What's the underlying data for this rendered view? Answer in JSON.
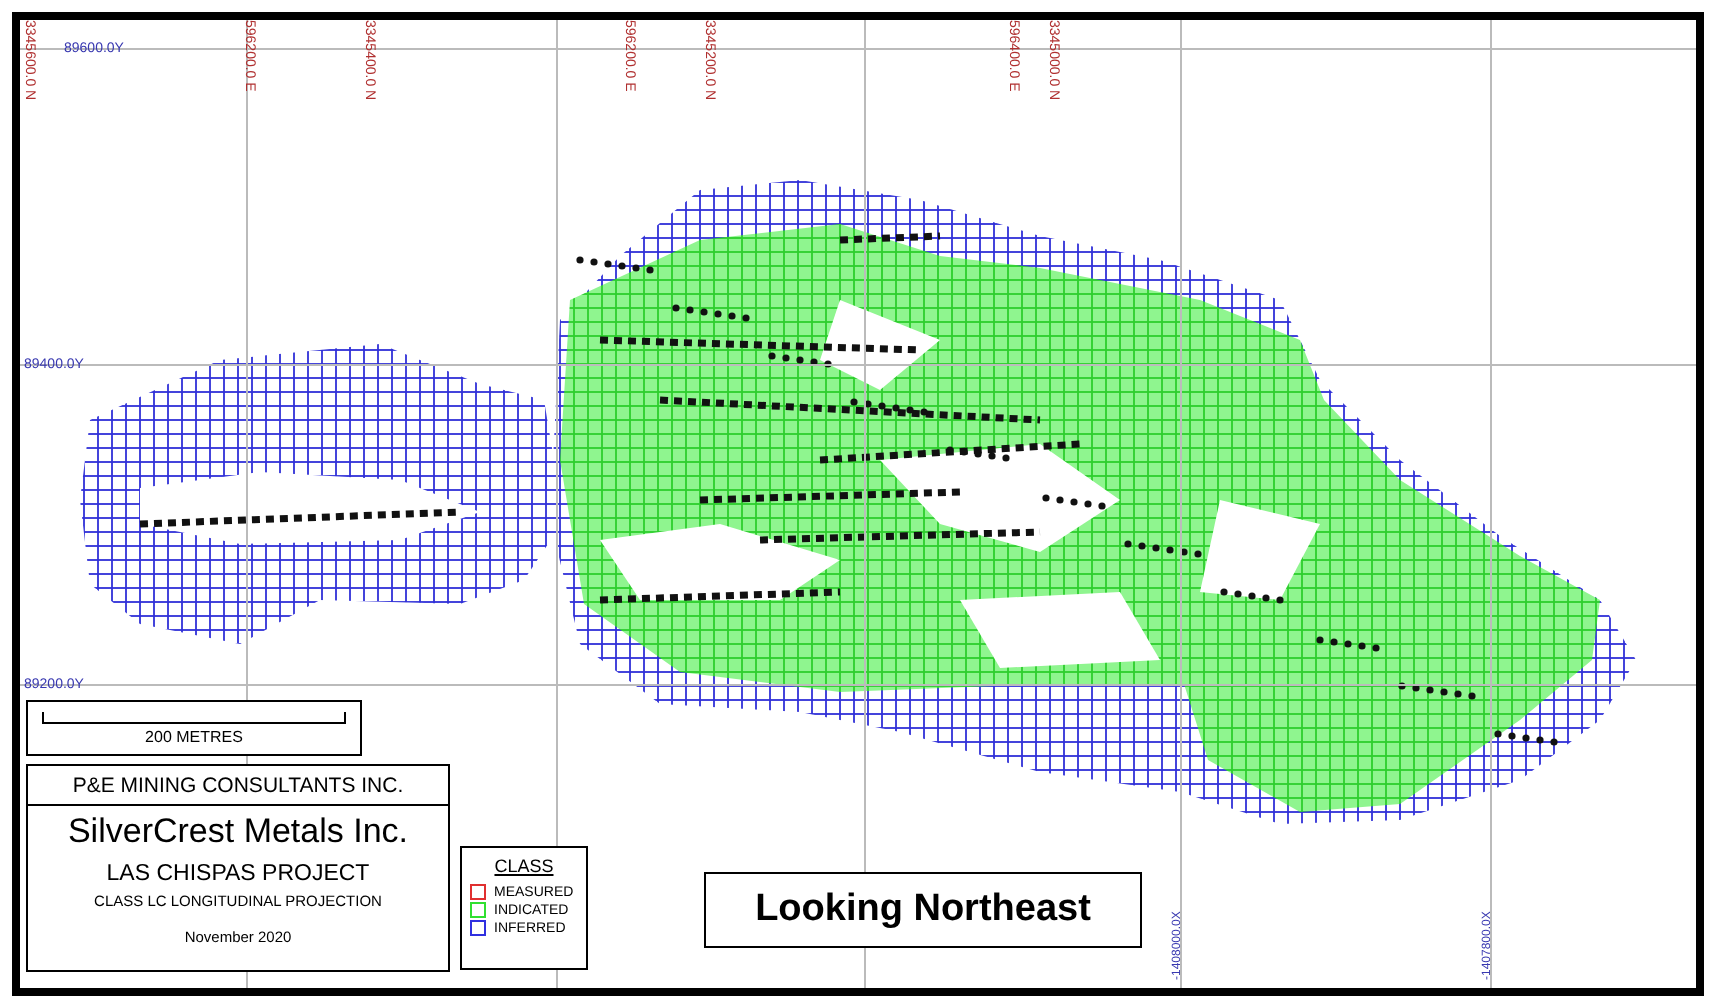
{
  "map": {
    "top_labels": [
      "3345600.0 N",
      "596200.0 E",
      "3345400.0 N",
      "596200.0 E",
      "3345200.0 N",
      "596400.0 E",
      "3345000.0 N"
    ],
    "left_labels": [
      "89600.0Y",
      "89400.0Y",
      "89200.0Y"
    ],
    "bottom_labels": [
      "-1408000.0X",
      "-1407800.0X"
    ]
  },
  "scale_bar": {
    "label": "200 METRES"
  },
  "title_block": {
    "company": "P&E MINING CONSULTANTS INC.",
    "client": "SilverCrest Metals Inc.",
    "project": "LAS CHISPAS PROJECT",
    "subtitle": "CLASS LC LONGITUDINAL PROJECTION",
    "date": "November 2020"
  },
  "legend": {
    "title": "CLASS",
    "items": [
      {
        "label": "MEASURED",
        "color": "#e03030"
      },
      {
        "label": "INDICATED",
        "color": "#30e030"
      },
      {
        "label": "INFERRED",
        "color": "#3030e0"
      }
    ]
  },
  "view_label": "Looking Northeast"
}
